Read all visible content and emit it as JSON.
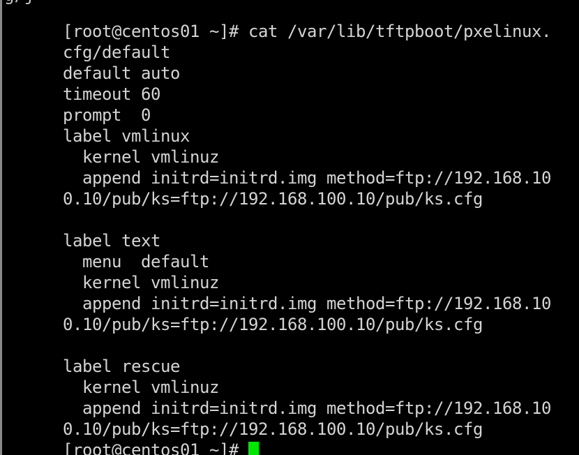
{
  "terminal": {
    "window_kind": "linux-terminal",
    "background_color": "#000000",
    "foreground_color": "#d4d4d4",
    "cursor_color": "#00e800",
    "edge_color": "#8a8a8a",
    "hostname": "centos01",
    "user": "root",
    "prompt": "[root@centos01 ~]# ",
    "command": "cat /var/lib/tftpboot/pxelinux.cfg/default",
    "scrollback_ghost": "g/j",
    "lines": [
      {
        "id": "line-command",
        "text": "[root@centos01 ~]# cat /var/lib/tftpboot/pxelinux."
      },
      {
        "id": "line-command-wrap",
        "text": "cfg/default"
      },
      {
        "id": "line-default-auto",
        "text": "default auto"
      },
      {
        "id": "line-timeout",
        "text": "timeout 60"
      },
      {
        "id": "line-prompt-0",
        "text": "prompt  0"
      },
      {
        "id": "line-label-vmlinux",
        "text": "label vmlinux"
      },
      {
        "id": "line-kernel-1",
        "text": "  kernel vmlinuz"
      },
      {
        "id": "line-append-1",
        "text": "  append initrd=initrd.img method=ftp://192.168.10"
      },
      {
        "id": "line-append-1-wrap",
        "text": "0.10/pub/ks=ftp://192.168.100.10/pub/ks.cfg"
      },
      {
        "id": "line-blank-1",
        "text": ""
      },
      {
        "id": "line-label-text",
        "text": "label text"
      },
      {
        "id": "line-menu-default",
        "text": "  menu  default"
      },
      {
        "id": "line-kernel-2",
        "text": "  kernel vmlinuz"
      },
      {
        "id": "line-append-2",
        "text": "  append initrd=initrd.img method=ftp://192.168.10"
      },
      {
        "id": "line-append-2-wrap",
        "text": "0.10/pub/ks=ftp://192.168.100.10/pub/ks.cfg"
      },
      {
        "id": "line-blank-2",
        "text": ""
      },
      {
        "id": "line-label-rescue",
        "text": "label rescue"
      },
      {
        "id": "line-kernel-3",
        "text": "  kernel vmlinuz"
      },
      {
        "id": "line-append-3",
        "text": "  append initrd=initrd.img method=ftp://192.168.10"
      },
      {
        "id": "line-append-3-wrap",
        "text": "0.10/pub/ks=ftp://192.168.100.10/pub/ks.cfg"
      }
    ],
    "final_prompt": "[root@centos01 ~]# "
  }
}
